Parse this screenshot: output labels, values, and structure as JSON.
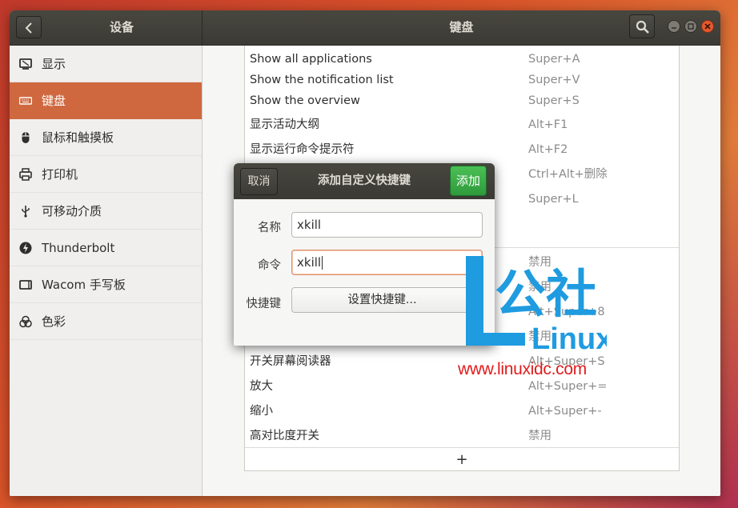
{
  "header": {
    "left_title": "设备",
    "main_title": "键盘"
  },
  "sidebar": {
    "items": [
      {
        "label": "显示",
        "icon": "display-icon"
      },
      {
        "label": "键盘",
        "icon": "keyboard-icon",
        "active": true
      },
      {
        "label": "鼠标和触摸板",
        "icon": "mouse-icon"
      },
      {
        "label": "打印机",
        "icon": "printer-icon"
      },
      {
        "label": "可移动介质",
        "icon": "usb-icon"
      },
      {
        "label": "Thunderbolt",
        "icon": "thunderbolt-icon"
      },
      {
        "label": "Wacom 手写板",
        "icon": "tablet-icon"
      },
      {
        "label": "色彩",
        "icon": "color-icon"
      }
    ]
  },
  "shortcuts": [
    {
      "name": "Show all applications",
      "key": "Super+A"
    },
    {
      "name": "Show the notification list",
      "key": "Super+V"
    },
    {
      "name": "Show the overview",
      "key": "Super+S"
    },
    {
      "name": "显示活动大纲",
      "key": "Alt+F1"
    },
    {
      "name": "显示运行命令提示符",
      "key": "Alt+F2"
    },
    {
      "name": "",
      "key": "Ctrl+Alt+删除"
    },
    {
      "name": "",
      "key": "Super+L"
    },
    {
      "name": "",
      "key": "禁用"
    },
    {
      "name": "",
      "key": "禁用"
    },
    {
      "name": "",
      "key": "Alt+Super+8"
    },
    {
      "name": "",
      "key": "禁用"
    },
    {
      "name": "开关屏幕阅读器",
      "key": "Alt+Super+S"
    },
    {
      "name": "放大",
      "key": "Alt+Super+="
    },
    {
      "name": "缩小",
      "key": "Alt+Super+-"
    },
    {
      "name": "高对比度开关",
      "key": "禁用"
    }
  ],
  "add_row_label": "+",
  "dialog": {
    "cancel_label": "取消",
    "title": "添加自定义快捷键",
    "add_label": "添加",
    "name_label": "名称",
    "name_value": "xkill",
    "command_label": "命令",
    "command_value": "xkill",
    "shortcut_label": "快捷键",
    "shortcut_button": "设置快捷键..."
  },
  "watermark": {
    "logo_text": "公社",
    "brand": "Linux",
    "url": "www.linuxidc.com"
  },
  "colors": {
    "accent": "#d0683f",
    "add_button": "#3aa847",
    "watermark_blue": "#1f9be0",
    "watermark_red": "#e11b1b"
  }
}
